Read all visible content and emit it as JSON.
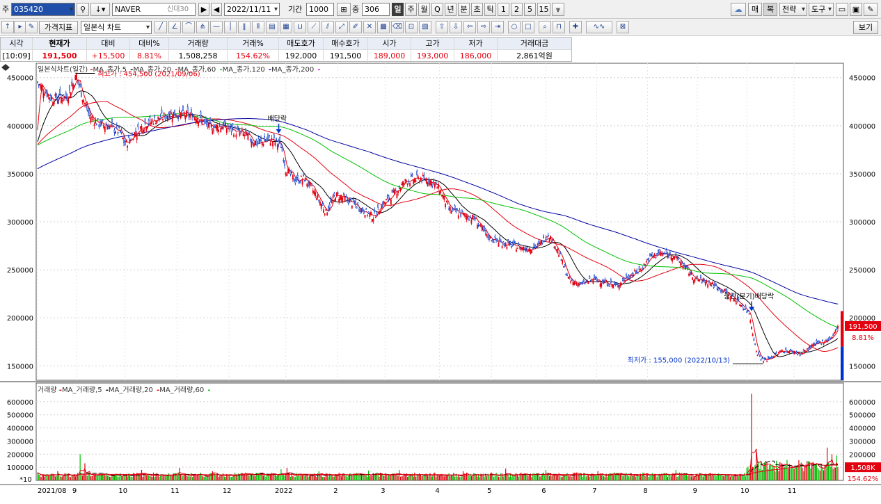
{
  "toolbar": {
    "market_label": "주",
    "stock_code": "035420",
    "stock_name": "NAVER",
    "credit_badge": "신대30",
    "date": "2022/11/11",
    "period_label": "기간",
    "period_value": "1000",
    "count_label": "중",
    "count_value": "306",
    "timeframes": [
      "일",
      "주",
      "월",
      "Q",
      "년",
      "분",
      "초",
      "틱",
      "1",
      "2",
      "5",
      "15"
    ],
    "active_timeframe": "일",
    "right_buttons": [
      "매",
      "복",
      "전략",
      "도구"
    ],
    "view_label": "보기"
  },
  "toolbar2": {
    "indicator_button": "가격지표",
    "chart_type": "일본식 차트"
  },
  "quote": {
    "headers": [
      "시각",
      "현재가",
      "대비",
      "대비%",
      "거래량",
      "거래%",
      "매도호가",
      "매수호가",
      "시가",
      "고가",
      "저가",
      "거래대금"
    ],
    "values": [
      "[10:09]",
      "191,500",
      "+15,500",
      "8.81%",
      "1,508,258",
      "154.62%",
      "192,000",
      "191,500",
      "189,000",
      "193,000",
      "186,000",
      "2,861억원"
    ]
  },
  "chart_data": [
    {
      "type": "candlestick",
      "title": "일본식차트(일간)",
      "legend": [
        "MA_종가,5",
        "MA_종가,20",
        "MA_종가,60",
        "MA_종가,120",
        "MA_종가,200"
      ],
      "ma_colors": [
        "#e3000f",
        "#000000",
        "#e3000f",
        "#00c000",
        "#0000a0",
        "#e000e0"
      ],
      "ylim": [
        135000,
        465000
      ],
      "y_ticks": [
        150000,
        200000,
        250000,
        300000,
        350000,
        400000,
        450000
      ],
      "y_tick_labels": [
        "150000",
        "200000",
        "250000",
        "300000",
        "350000",
        "400000",
        "450000"
      ],
      "x_tick_labels": [
        "2021/08",
        "9",
        "10",
        "11",
        "12",
        "2022",
        "2",
        "3",
        "4",
        "5",
        "6",
        "7",
        "8",
        "9",
        "10",
        "11"
      ],
      "x_tick_index": [
        0,
        33,
        74,
        118,
        162,
        210,
        254,
        294,
        340,
        384,
        430,
        473,
        516,
        558,
        600,
        640
      ],
      "n_days": 678,
      "price_path": [
        [
          0,
          445000
        ],
        [
          12,
          428000
        ],
        [
          25,
          430000
        ],
        [
          33,
          452000
        ],
        [
          38,
          430000
        ],
        [
          44,
          410000
        ],
        [
          52,
          402000
        ],
        [
          60,
          400000
        ],
        [
          70,
          393000
        ],
        [
          74,
          380000
        ],
        [
          82,
          392000
        ],
        [
          92,
          403000
        ],
        [
          104,
          408000
        ],
        [
          114,
          413000
        ],
        [
          124,
          411000
        ],
        [
          134,
          410000
        ],
        [
          146,
          398000
        ],
        [
          156,
          400000
        ],
        [
          166,
          395000
        ],
        [
          176,
          390000
        ],
        [
          186,
          381000
        ],
        [
          196,
          386000
        ],
        [
          206,
          380000
        ],
        [
          210,
          355000
        ],
        [
          218,
          343000
        ],
        [
          226,
          345000
        ],
        [
          236,
          327000
        ],
        [
          244,
          310000
        ],
        [
          252,
          328000
        ],
        [
          262,
          323000
        ],
        [
          274,
          313000
        ],
        [
          284,
          305000
        ],
        [
          292,
          318000
        ],
        [
          302,
          330000
        ],
        [
          312,
          343000
        ],
        [
          324,
          345000
        ],
        [
          332,
          343000
        ],
        [
          340,
          334000
        ],
        [
          348,
          313000
        ],
        [
          358,
          308000
        ],
        [
          370,
          303000
        ],
        [
          380,
          285000
        ],
        [
          392,
          278000
        ],
        [
          402,
          275000
        ],
        [
          414,
          272000
        ],
        [
          424,
          275000
        ],
        [
          432,
          288000
        ],
        [
          440,
          270000
        ],
        [
          450,
          238000
        ],
        [
          460,
          235000
        ],
        [
          470,
          240000
        ],
        [
          480,
          237000
        ],
        [
          490,
          233000
        ],
        [
          500,
          243000
        ],
        [
          510,
          250000
        ],
        [
          518,
          263000
        ],
        [
          526,
          267000
        ],
        [
          538,
          265000
        ],
        [
          546,
          255000
        ],
        [
          556,
          240000
        ],
        [
          566,
          238000
        ],
        [
          576,
          231000
        ],
        [
          584,
          225000
        ],
        [
          594,
          215000
        ],
        [
          602,
          205000
        ],
        [
          608,
          165000
        ],
        [
          614,
          155000
        ],
        [
          622,
          160000
        ],
        [
          630,
          166000
        ],
        [
          638,
          165000
        ],
        [
          646,
          162000
        ],
        [
          654,
          170000
        ],
        [
          664,
          175000
        ],
        [
          672,
          180000
        ],
        [
          678,
          191500
        ]
      ],
      "annotations": [
        {
          "text": "최고가 : 454,500 (2021/09/06)",
          "value": 454500,
          "index": 32
        },
        {
          "text": "최저가 : 155,000 (2022/10/13)",
          "value": 155000,
          "index": 614
        },
        {
          "text": "배당락",
          "value": 392000,
          "index": 204
        },
        {
          "text": "중간(분기)배당락",
          "value": 207000,
          "index": 604
        }
      ],
      "current_price_label": "191,500",
      "current_change_label": "8.81%"
    },
    {
      "type": "bar",
      "title": "거래량",
      "legend": [
        "MA_거래량,5",
        "MA_거래량,20",
        "MA_거래량,60"
      ],
      "ylim": [
        0,
        700000
      ],
      "y_ticks": [
        100000,
        200000,
        300000,
        400000,
        500000,
        600000
      ],
      "y_tick_labels": [
        "100000",
        "200000",
        "300000",
        "400000",
        "500000",
        "600000"
      ],
      "unit_label": "*10",
      "spikes": [
        [
          0,
          60000
        ],
        [
          17,
          70000
        ],
        [
          36,
          200000
        ],
        [
          40,
          130000
        ],
        [
          88,
          80000
        ],
        [
          120,
          95000
        ],
        [
          148,
          70000
        ],
        [
          176,
          60000
        ],
        [
          206,
          85000
        ],
        [
          211,
          95000
        ],
        [
          238,
          70000
        ],
        [
          280,
          75000
        ],
        [
          306,
          80000
        ],
        [
          360,
          70000
        ],
        [
          396,
          90000
        ],
        [
          430,
          80000
        ],
        [
          474,
          70000
        ],
        [
          540,
          80000
        ],
        [
          600,
          95000
        ],
        [
          604,
          660000
        ],
        [
          608,
          220000
        ],
        [
          612,
          150000
        ],
        [
          620,
          120000
        ],
        [
          640,
          90000
        ],
        [
          655,
          130000
        ],
        [
          668,
          250000
        ],
        [
          672,
          200000
        ],
        [
          676,
          190000
        ]
      ],
      "current_volume_label": "1,508K",
      "current_pct_label": "154.62%"
    }
  ]
}
